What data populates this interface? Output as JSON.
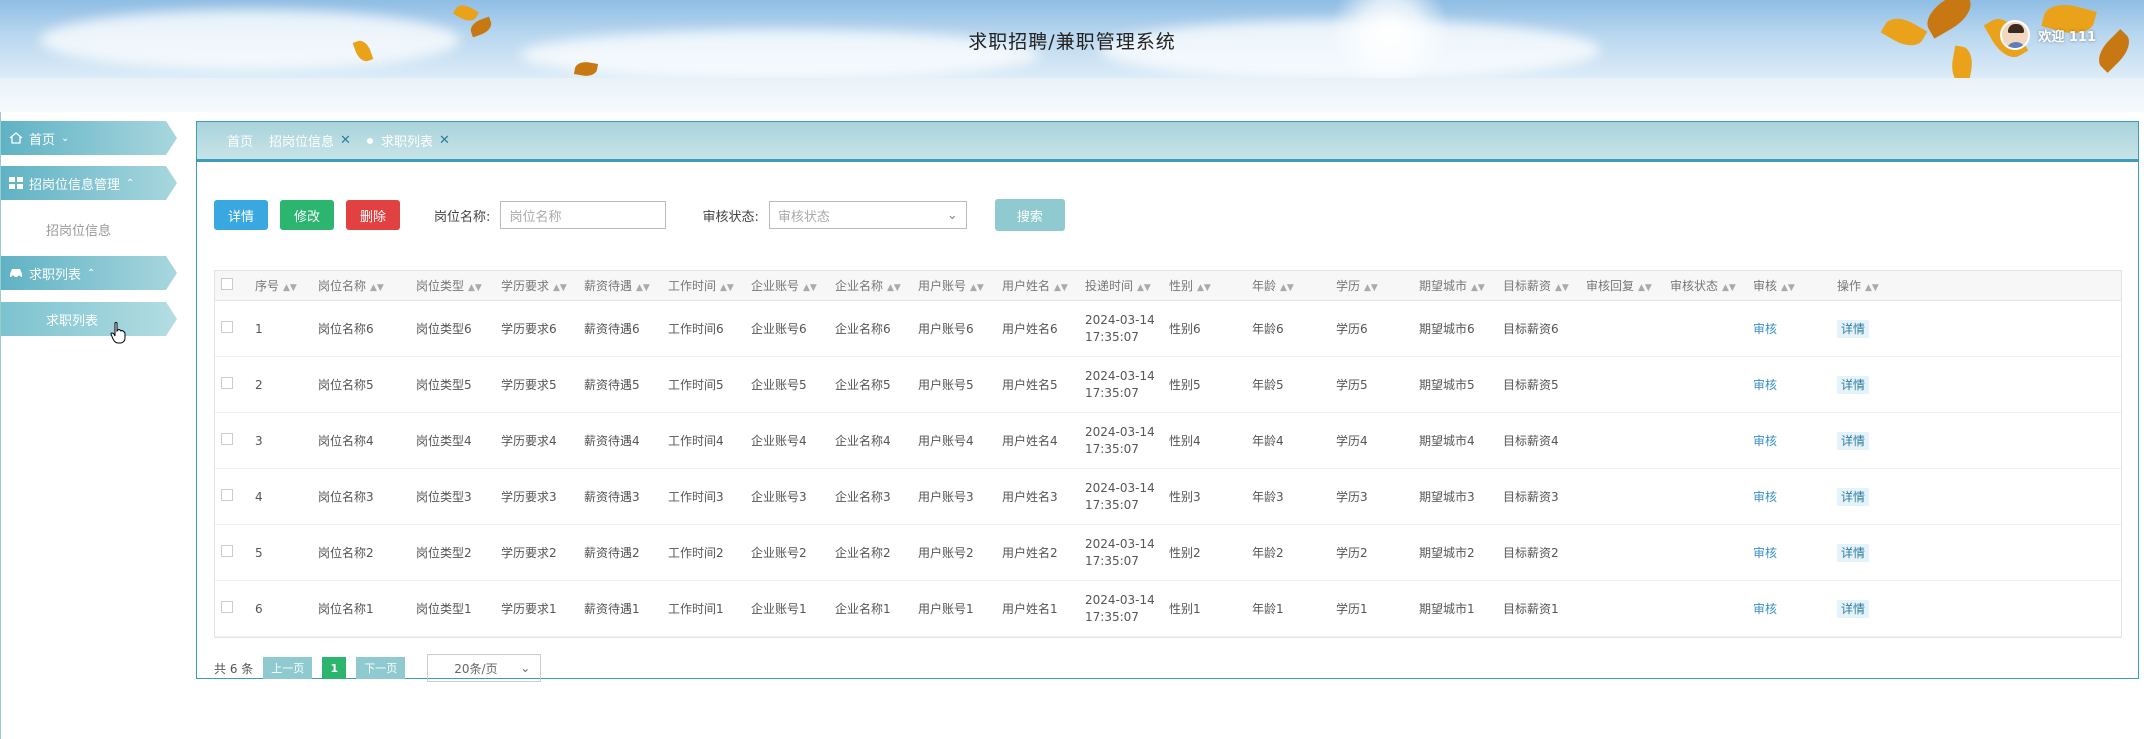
{
  "app": {
    "title": "求职招聘/兼职管理系统",
    "welcome": "欢迎 111"
  },
  "sidebar": {
    "home": "首页",
    "group1": {
      "label": "招岗位信息管理",
      "sub": "招岗位信息"
    },
    "group2": {
      "label": "求职列表",
      "sub": "求职列表"
    }
  },
  "tabs": [
    {
      "label": "首页"
    },
    {
      "label": "招岗位信息"
    },
    {
      "label": "求职列表"
    }
  ],
  "toolbar": {
    "detail": "详情",
    "edit": "修改",
    "delete": "删除",
    "name_label": "岗位名称:",
    "name_placeholder": "岗位名称",
    "status_label": "审核状态:",
    "status_placeholder": "审核状态",
    "search": "搜索"
  },
  "table": {
    "headers": [
      "序号",
      "岗位名称",
      "岗位类型",
      "学历要求",
      "薪资待遇",
      "工作时间",
      "企业账号",
      "企业名称",
      "用户账号",
      "用户姓名",
      "投递时间",
      "性别",
      "年龄",
      "学历",
      "期望城市",
      "目标薪资",
      "审核回复",
      "审核状态",
      "审核",
      "操作"
    ],
    "rows": [
      [
        "1",
        "岗位名称6",
        "岗位类型6",
        "学历要求6",
        "薪资待遇6",
        "工作时间6",
        "企业账号6",
        "企业名称6",
        "用户账号6",
        "用户姓名6",
        "2024-03-14",
        "17:35:07",
        "性别6",
        "年龄6",
        "学历6",
        "期望城市6",
        "目标薪资6",
        "",
        "",
        "审核",
        "详情"
      ],
      [
        "2",
        "岗位名称5",
        "岗位类型5",
        "学历要求5",
        "薪资待遇5",
        "工作时间5",
        "企业账号5",
        "企业名称5",
        "用户账号5",
        "用户姓名5",
        "2024-03-14",
        "17:35:07",
        "性别5",
        "年龄5",
        "学历5",
        "期望城市5",
        "目标薪资5",
        "",
        "",
        "审核",
        "详情"
      ],
      [
        "3",
        "岗位名称4",
        "岗位类型4",
        "学历要求4",
        "薪资待遇4",
        "工作时间4",
        "企业账号4",
        "企业名称4",
        "用户账号4",
        "用户姓名4",
        "2024-03-14",
        "17:35:07",
        "性别4",
        "年龄4",
        "学历4",
        "期望城市4",
        "目标薪资4",
        "",
        "",
        "审核",
        "详情"
      ],
      [
        "4",
        "岗位名称3",
        "岗位类型3",
        "学历要求3",
        "薪资待遇3",
        "工作时间3",
        "企业账号3",
        "企业名称3",
        "用户账号3",
        "用户姓名3",
        "2024-03-14",
        "17:35:07",
        "性别3",
        "年龄3",
        "学历3",
        "期望城市3",
        "目标薪资3",
        "",
        "",
        "审核",
        "详情"
      ],
      [
        "5",
        "岗位名称2",
        "岗位类型2",
        "学历要求2",
        "薪资待遇2",
        "工作时间2",
        "企业账号2",
        "企业名称2",
        "用户账号2",
        "用户姓名2",
        "2024-03-14",
        "17:35:07",
        "性别2",
        "年龄2",
        "学历2",
        "期望城市2",
        "目标薪资2",
        "",
        "",
        "审核",
        "详情"
      ],
      [
        "6",
        "岗位名称1",
        "岗位类型1",
        "学历要求1",
        "薪资待遇1",
        "工作时间1",
        "企业账号1",
        "企业名称1",
        "用户账号1",
        "用户姓名1",
        "2024-03-14",
        "17:35:07",
        "性别1",
        "年龄1",
        "学历1",
        "期望城市1",
        "目标薪资1",
        "",
        "",
        "审核",
        "详情"
      ]
    ]
  },
  "pager": {
    "total": "共 6 条",
    "prev": "上一页",
    "page": "1",
    "next": "下一页",
    "size": "20条/页"
  }
}
